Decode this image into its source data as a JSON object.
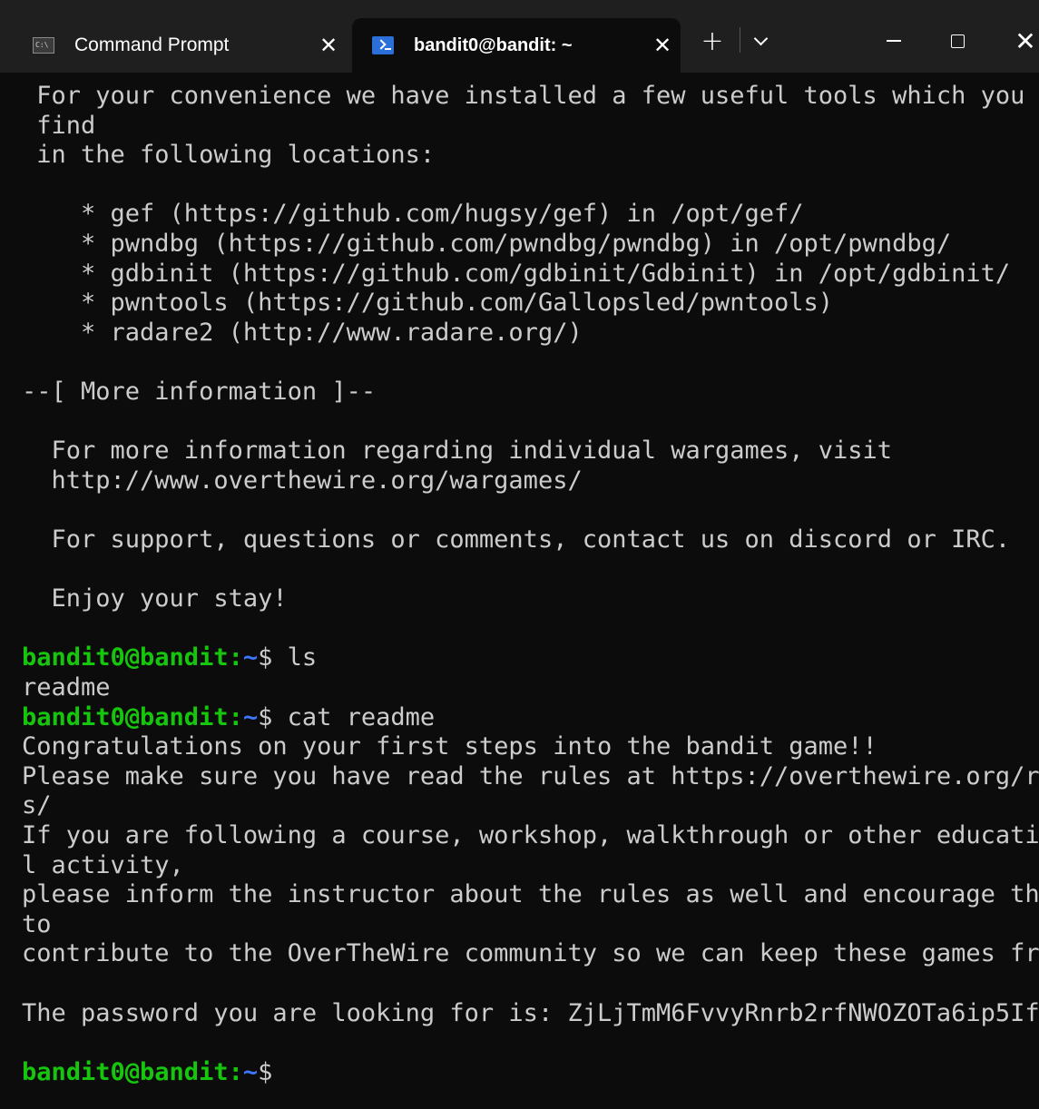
{
  "tabs": [
    {
      "title": "Command Prompt",
      "icon": "cmd-icon",
      "active": false
    },
    {
      "title": "bandit0@bandit: ~",
      "icon": "powershell-icon",
      "active": true
    }
  ],
  "titlebar": {
    "new_tab_glyph": "+",
    "close_glyph": "✕",
    "window_close_glyph": "✕"
  },
  "terminal": {
    "lines": [
      " For your convenience we have installed a few useful tools which you can",
      " find",
      " in the following locations:",
      "",
      "    * gef (https://github.com/hugsy/gef) in /opt/gef/",
      "    * pwndbg (https://github.com/pwndbg/pwndbg) in /opt/pwndbg/",
      "    * gdbinit (https://github.com/gdbinit/Gdbinit) in /opt/gdbinit/",
      "    * pwntools (https://github.com/Gallopsled/pwntools)",
      "    * radare2 (http://www.radare.org/)",
      "",
      "--[ More information ]--",
      "",
      "  For more information regarding individual wargames, visit",
      "  http://www.overthewire.org/wargames/",
      "",
      "  For support, questions or comments, contact us on discord or IRC.",
      "",
      "  Enjoy your stay!",
      "",
      "bandit0@bandit:~$ ls",
      "readme",
      "bandit0@bandit:~$ cat readme",
      "Congratulations on your first steps into the bandit game!!",
      "Please make sure you have read the rules at https://overthewire.org/rule",
      "s/",
      "If you are following a course, workshop, walkthrough or other educationa",
      "l activity,",
      "please inform the instructor about the rules as well and encourage them",
      "to",
      "contribute to the OverTheWire community so we can keep these games free!",
      "",
      "The password you are looking for is: ZjLjTmM6FvvyRnrb2rfNWOZOTa6ip5If",
      "",
      "bandit0@bandit:~$"
    ],
    "prompt": {
      "user_host": "bandit0@bandit",
      "colon": ":",
      "path": "~",
      "symbol": "$"
    }
  },
  "colors": {
    "background": "#0c0c0c",
    "titlebar": "#1f1f1f",
    "text": "#cccccc",
    "prompt_user": "#16c60c",
    "prompt_path": "#3b78ff"
  }
}
